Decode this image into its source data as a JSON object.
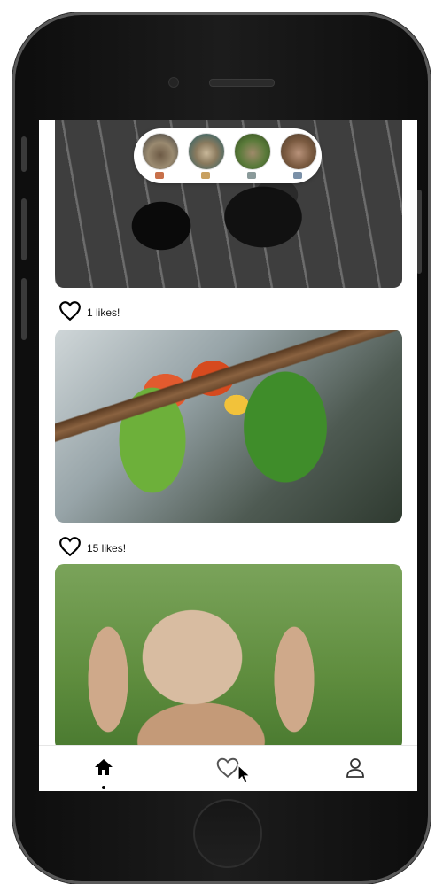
{
  "app": {
    "stories": [
      {
        "name": "story-1"
      },
      {
        "name": "story-2"
      },
      {
        "name": "story-3"
      },
      {
        "name": "story-4"
      }
    ],
    "posts": [
      {
        "image": "dogs-photo",
        "likes_text": null
      },
      {
        "image": "lovebirds-photo",
        "likes_text": "1 likes!"
      },
      {
        "image": "bunny-photo",
        "likes_text": "15 likes!"
      }
    ],
    "nav": {
      "items": [
        {
          "icon": "home-icon",
          "active": true
        },
        {
          "icon": "heart-icon",
          "active": false
        },
        {
          "icon": "profile-icon",
          "active": false
        }
      ]
    },
    "colors": {
      "accent": "#000000",
      "background": "#ffffff"
    }
  }
}
